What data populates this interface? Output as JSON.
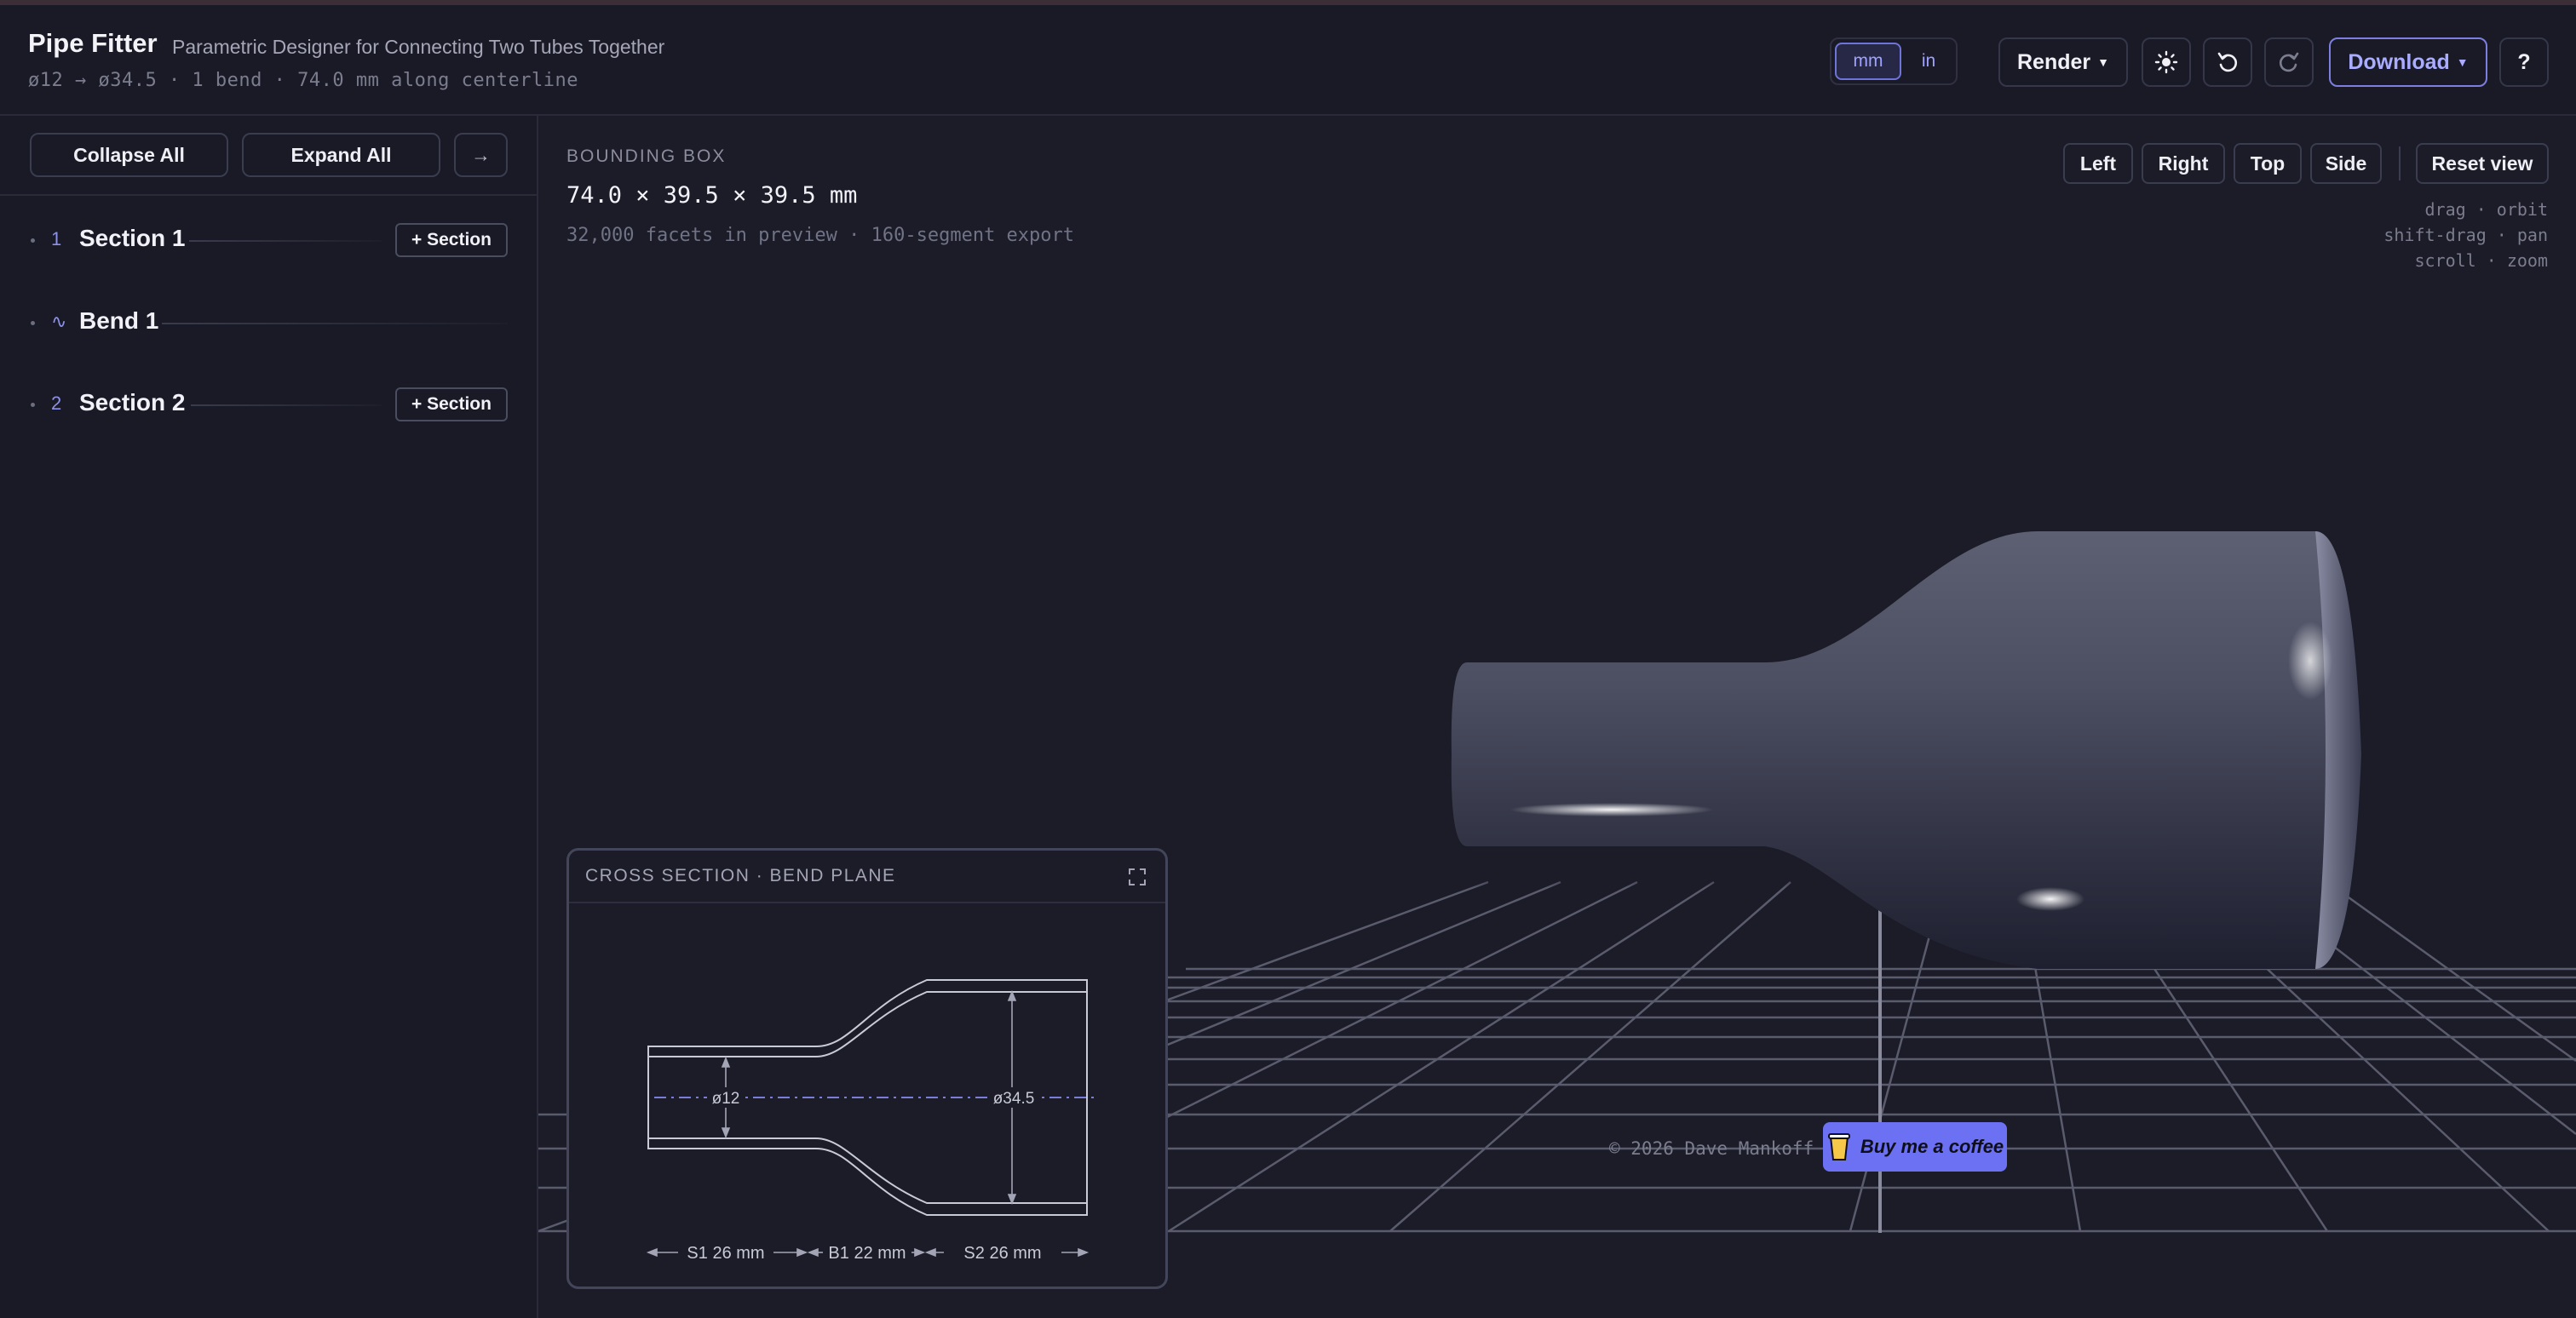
{
  "header": {
    "title": "Pipe Fitter",
    "subtitle": "Parametric Designer for Connecting Two Tubes Together",
    "meta": "ø12 → ø34.5 · 1 bend · 74.0 mm along centerline",
    "units": {
      "mm": "mm",
      "in": "in",
      "selected": "mm"
    },
    "render_label": "Render",
    "download_label": "Download",
    "help_label": "?",
    "icons": {
      "theme": "sun-icon",
      "undo": "undo-icon",
      "redo": "redo-icon"
    }
  },
  "sidebar": {
    "collapse_all": "Collapse All",
    "expand_all": "Expand All",
    "arrow": "→",
    "items": [
      {
        "num": "1",
        "label": "Section 1",
        "add": "+ Section"
      },
      {
        "num": "∿",
        "label": "Bend 1"
      },
      {
        "num": "2",
        "label": "Section 2",
        "add": "+ Section"
      }
    ]
  },
  "viewport": {
    "bbox_label": "BOUNDING BOX",
    "bbox_value": "74.0 × 39.5 × 39.5 mm",
    "facets": "32,000 facets in preview · 160-segment export",
    "view_buttons": {
      "left": "Left",
      "right": "Right",
      "top": "Top",
      "side": "Side",
      "reset": "Reset view"
    },
    "hints": [
      "drag · orbit",
      "shift-drag · pan",
      "scroll · zoom"
    ]
  },
  "cross_section": {
    "title": "CROSS SECTION · BEND PLANE",
    "small_diameter": "ø12",
    "large_diameter": "ø34.5",
    "s1": "S1 26 mm",
    "b1": "B1 22 mm",
    "s2": "S2 26 mm"
  },
  "footer": {
    "copyright": "© 2026 Dave Mankoff",
    "coffee": "Buy me a coffee"
  },
  "colors": {
    "accent": "#8d91e8",
    "coffee": "#6c70f2",
    "background": "#1a1b27"
  }
}
